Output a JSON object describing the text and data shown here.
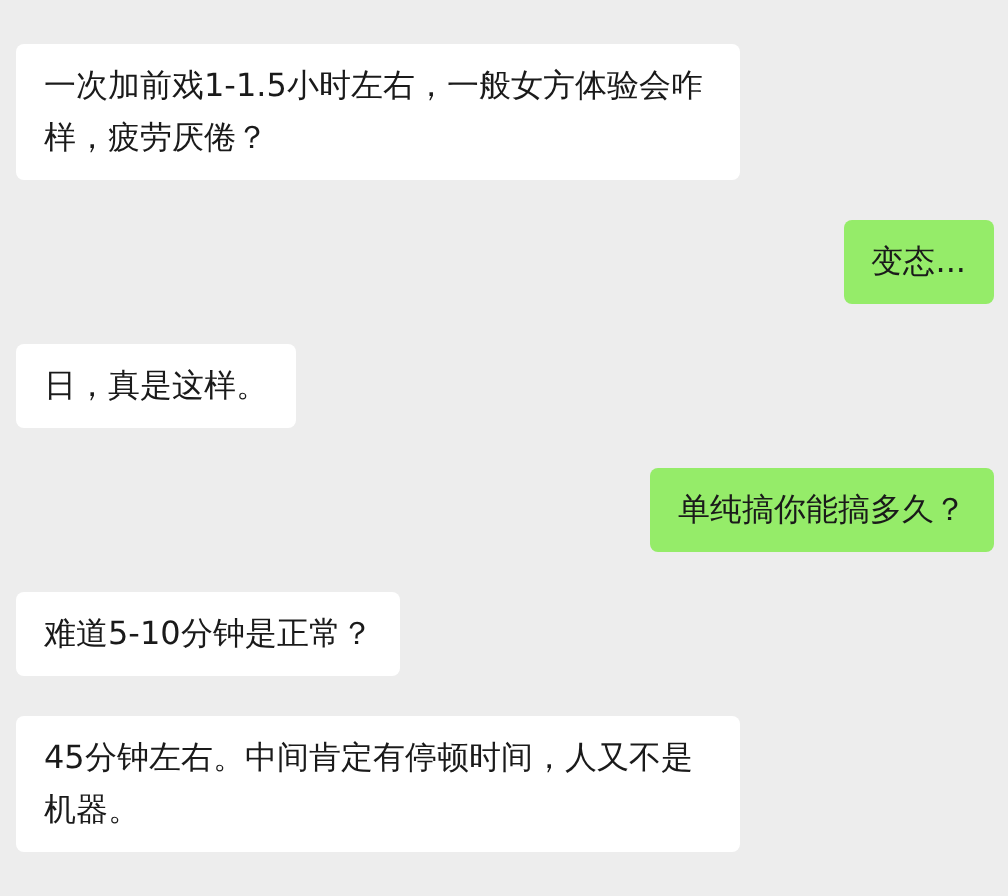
{
  "messages": [
    {
      "kind": "received",
      "text": "一次加前戏1-1.5小时左右，一般女方体验会咋样，疲劳厌倦？"
    },
    {
      "kind": "sent",
      "text": "变态..."
    },
    {
      "kind": "received",
      "text": "日，真是这样。"
    },
    {
      "kind": "sent",
      "text": "单纯搞你能搞多久？"
    },
    {
      "kind": "received",
      "text": "难道5-10分钟是正常？"
    },
    {
      "kind": "received",
      "text": "45分钟左右。中间肯定有停顿时间，人又不是机器。"
    }
  ]
}
